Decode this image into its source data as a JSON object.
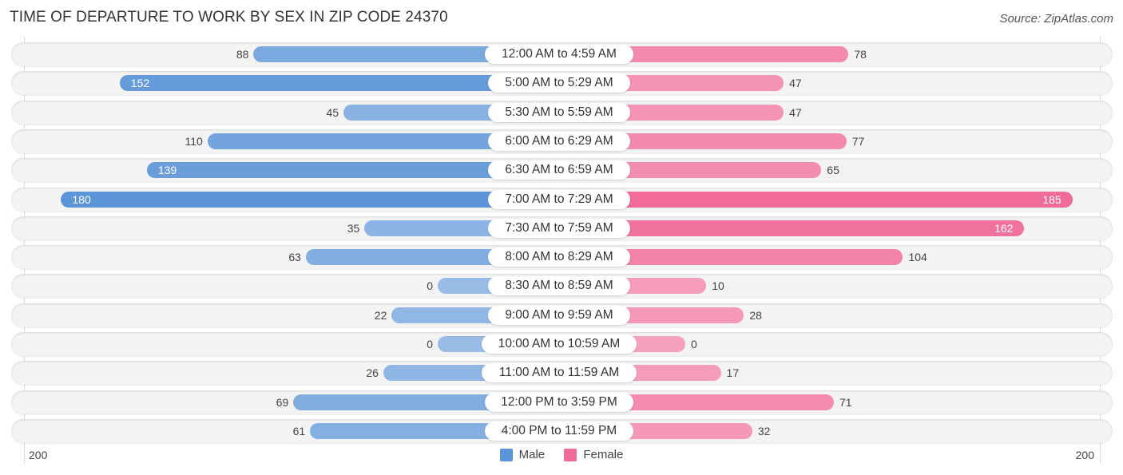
{
  "chart_data": {
    "type": "bar",
    "orientation": "horizontal-diverging",
    "title": "TIME OF DEPARTURE TO WORK BY SEX IN ZIP CODE 24370",
    "source": "Source: ZipAtlas.com",
    "categories": [
      "12:00 AM to 4:59 AM",
      "5:00 AM to 5:29 AM",
      "5:30 AM to 5:59 AM",
      "6:00 AM to 6:29 AM",
      "6:30 AM to 6:59 AM",
      "7:00 AM to 7:29 AM",
      "7:30 AM to 7:59 AM",
      "8:00 AM to 8:29 AM",
      "8:30 AM to 8:59 AM",
      "9:00 AM to 9:59 AM",
      "10:00 AM to 10:59 AM",
      "11:00 AM to 11:59 AM",
      "12:00 PM to 3:59 PM",
      "4:00 PM to 11:59 PM"
    ],
    "series": [
      {
        "name": "Male",
        "color": "#6a9fdc",
        "values": [
          88,
          152,
          45,
          110,
          139,
          180,
          35,
          63,
          0,
          22,
          0,
          26,
          69,
          61
        ]
      },
      {
        "name": "Female",
        "color": "#f06b96",
        "values": [
          78,
          47,
          47,
          77,
          65,
          185,
          162,
          104,
          10,
          28,
          0,
          17,
          71,
          32
        ]
      }
    ],
    "axis": {
      "left_tick": "200",
      "right_tick": "200",
      "range": [
        0,
        200
      ]
    },
    "legend": {
      "position": "bottom-center",
      "items": [
        "Male",
        "Female"
      ]
    }
  }
}
